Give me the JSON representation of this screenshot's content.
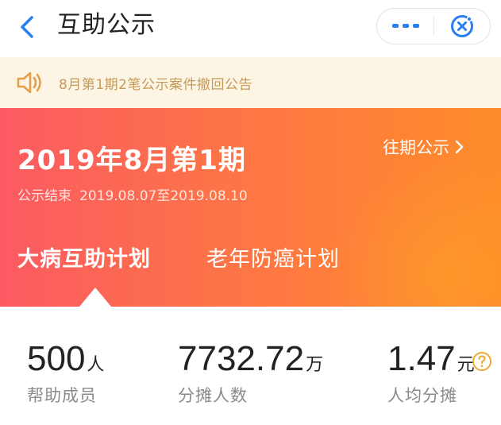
{
  "header": {
    "title": "互助公示",
    "back_icon": "chevron-left-icon",
    "more_icon": "more-dots-icon",
    "close_icon": "close-miniapp-icon"
  },
  "notice": {
    "icon": "speaker-icon",
    "text": "8月第1期2笔公示案件撤回公告"
  },
  "banner": {
    "period": "2019年8月第1期",
    "range_label": "公示结束",
    "range_dates": "2019.08.07至2019.08.10",
    "history_link": "往期公示",
    "tabs": [
      {
        "label": "大病互助计划",
        "selected": true
      },
      {
        "label": "老年防癌计划",
        "selected": false
      }
    ]
  },
  "stats": [
    {
      "value": "500",
      "unit": "人",
      "label": "帮助成员"
    },
    {
      "value": "7732.72",
      "unit": "万",
      "label": "分摊人数"
    },
    {
      "value": "1.47",
      "unit": "元",
      "label": "人均分摊"
    }
  ],
  "colors": {
    "accent_blue": "#2a7ff0",
    "banner_start": "#fb5a62",
    "banner_end": "#ff8c2a",
    "notice_bg": "#fdf5e3",
    "notice_text": "#c59a5a",
    "help_icon": "#f0a733"
  }
}
